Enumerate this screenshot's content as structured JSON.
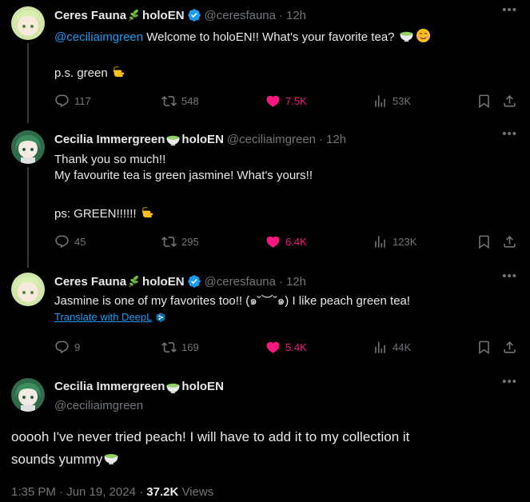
{
  "tweets": [
    {
      "name": "Ceres Fauna",
      "name_suffix": "holoEN",
      "handle": "@ceresfauna",
      "dot": "·",
      "time": "12h",
      "mention": "@ceciliaimgreen",
      "line1": " Welcome to holoEN!! What's your favorite tea?",
      "line2": "p.s. green",
      "replies": "117",
      "reposts": "548",
      "likes": "7.5K",
      "views": "53K"
    },
    {
      "name": "Cecilia Immergreen",
      "name_suffix": "holoEN",
      "handle": "@ceciliaimgreen",
      "dot": "·",
      "time": "12h",
      "line1": "Thank you so much!!",
      "line2": "My favourite tea is green jasmine! What's yours!!",
      "line3": "ps: GREEN!!!!!!",
      "replies": "45",
      "reposts": "295",
      "likes": "6.4K",
      "views": "123K"
    },
    {
      "name": "Ceres Fauna",
      "name_suffix": "holoEN",
      "handle": "@ceresfauna",
      "dot": "·",
      "time": "12h",
      "line1": "Jasmine is one of my favorites too!! (๑˘︶˘๑) I like peach green tea!",
      "translate": "Translate with DeepL",
      "replies": "9",
      "reposts": "169",
      "likes": "5.4K",
      "views": "44K"
    }
  ],
  "focus": {
    "name": "Cecilia Immergreen",
    "name_suffix": "holoEN",
    "handle": "@ceciliaimgreen",
    "line1": "ooooh I've never tried peach! I will have to add it to my collection it",
    "line2": "sounds yummy",
    "time": "1:35 PM · Jun 19, 2024 · ",
    "views_count": "37.2K",
    "views_label": " Views"
  },
  "colors": {
    "background": "#000000",
    "text": "#e7e9ea",
    "muted": "#71767b",
    "link": "#1d9bf0",
    "like": "#f91880",
    "verified": "#1d9bf0"
  },
  "icons": [
    "leaf-icon",
    "verified-badge-icon",
    "matcha-bowl-icon",
    "smiling-face-icon",
    "pointing-hand-icon",
    "reply-icon",
    "repost-icon",
    "heart-icon",
    "views-icon",
    "bookmark-icon",
    "share-icon",
    "more-icon",
    "deepl-icon"
  ]
}
